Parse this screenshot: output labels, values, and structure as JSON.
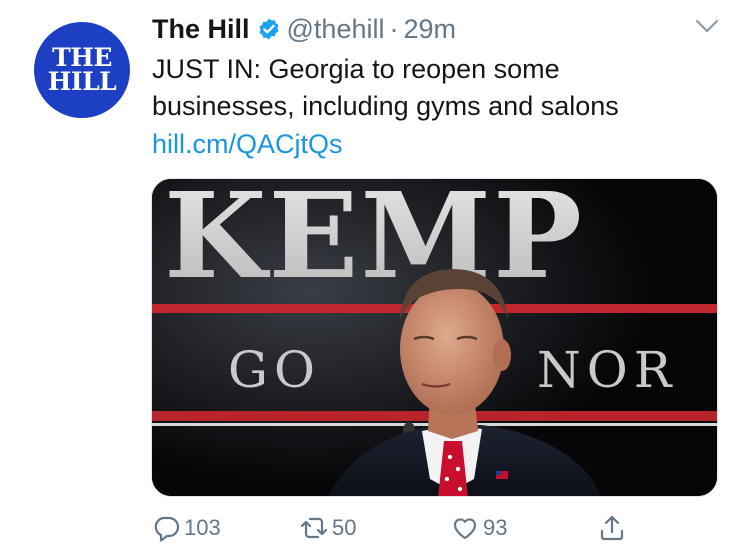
{
  "account": {
    "name": "The Hill",
    "handle": "@thehill",
    "separator": "·",
    "time": "29m",
    "avatar_line1": "THE",
    "avatar_line2": "HILL",
    "verified_icon": "verified-badge-icon",
    "brand_color": "#1d3fc3",
    "verified_color": "#1da1f2"
  },
  "tweet": {
    "text_line1": "JUST IN: Georgia to reopen some",
    "text_line2": "businesses, including gyms and salons",
    "link": "hill.cm/QACjtQs",
    "link_color": "#1b95e0"
  },
  "media": {
    "sign_top": "KEMP",
    "sign_bottom_left": "GO",
    "sign_bottom_right": "NOR"
  },
  "actions": {
    "reply_count": "103",
    "retweet_count": "50",
    "like_count": "93",
    "icons": [
      "reply-icon",
      "retweet-icon",
      "like-icon",
      "share-icon"
    ]
  }
}
